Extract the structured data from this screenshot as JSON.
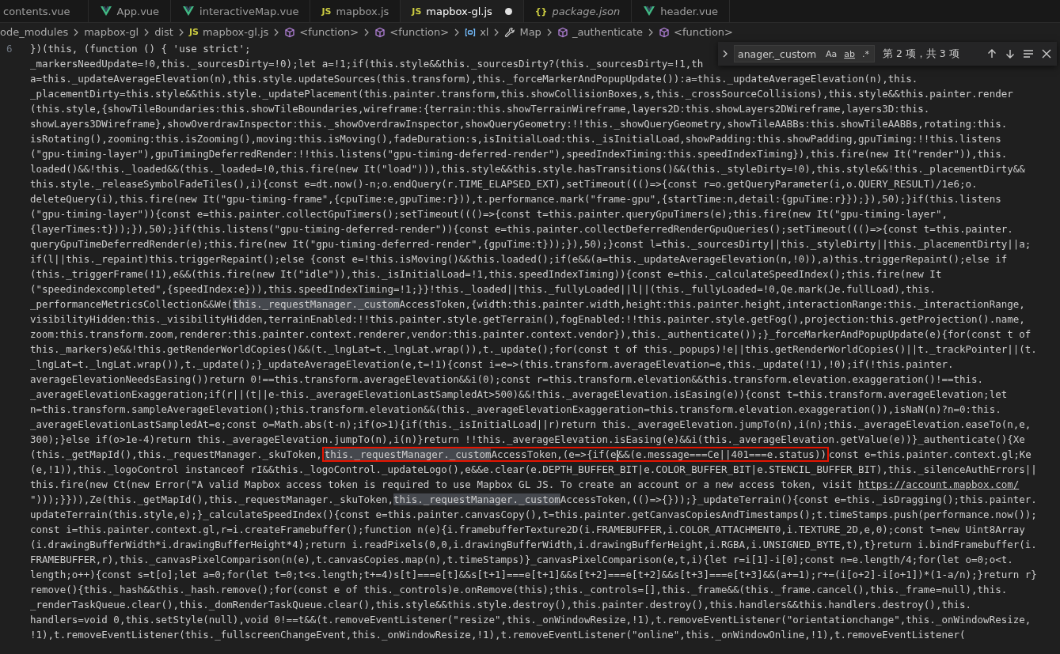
{
  "tabs": [
    {
      "label": "contents.vue",
      "selected": false,
      "modified": false,
      "preview": false
    },
    {
      "label": "App.vue",
      "kind": "vue",
      "selected": false,
      "modified": false,
      "preview": false
    },
    {
      "label": "interactiveMap.vue",
      "kind": "vue",
      "selected": false,
      "modified": false,
      "preview": false
    },
    {
      "label": "mapbox.js",
      "kind": "js",
      "icon_text": "JS",
      "selected": false,
      "modified": false,
      "preview": false
    },
    {
      "label": "mapbox-gl.js",
      "kind": "js",
      "icon_text": "JS",
      "selected": true,
      "modified": true,
      "preview": false
    },
    {
      "label": "package.json",
      "kind": "json",
      "icon_text": "{}",
      "selected": false,
      "modified": false,
      "preview": true
    },
    {
      "label": "header.vue",
      "kind": "vue",
      "selected": false,
      "modified": false,
      "preview": false
    }
  ],
  "breadcrumb": [
    {
      "label": "ode_modules"
    },
    {
      "label": "mapbox-gl"
    },
    {
      "label": "dist"
    },
    {
      "label": "mapbox-gl.js",
      "kind": "js",
      "icon_text": "JS"
    },
    {
      "label": "<function>",
      "kind": "function"
    },
    {
      "label": "<function>",
      "kind": "function"
    },
    {
      "label": "xl",
      "kind": "variable"
    },
    {
      "label": "Map",
      "kind": "property"
    },
    {
      "label": "_authenticate",
      "kind": "function"
    },
    {
      "label": "<function>",
      "kind": "function"
    }
  ],
  "find_widget": {
    "value": "anager._custom",
    "toggles": [
      {
        "kind": "case",
        "label": "Aa",
        "on": false
      },
      {
        "kind": "word",
        "label": "ab",
        "on": false
      },
      {
        "kind": "regex",
        "label": ".*",
        "on": false
      }
    ],
    "result": "第 2 项，共 3 项"
  },
  "editor": {
    "line_number": "6",
    "rows": [
      "})(this, (function () { 'use strict';",
      "_markersNeedUpdate=!0,this._sourcesDirty=!0);let a=!1;if(this.style&&this._sourcesDirty?(this._sourcesDirty=!1,th",
      "a=this._updateAverageElevation(n),this.style.updateSources(this.transform),this._forceMarkerAndPopupUpdate()):a=this._updateAverageElevation(n),this.",
      "_placementDirty=this.style&&this.style._updatePlacement(this.painter.transform,this.showCollisionBoxes,s,this._crossSourceCollisions),this.style&&this.painter.render",
      "(this.style,{showTileBoundaries:this.showTileBoundaries,wireframe:{terrain:this.showTerrainWireframe,layers2D:this.showLayers2DWireframe,layers3D:this.",
      "showLayers3DWireframe},showOverdrawInspector:this._showOverdrawInspector,showQueryGeometry:!!this._showQueryGeometry,showTileAABBs:this.showTileAABBs,rotating:this.",
      "isRotating(),zooming:this.isZooming(),moving:this.isMoving(),fadeDuration:s,isInitialLoad:this._isInitialLoad,showPadding:this.showPadding,gpuTiming:!!this.listens",
      "(\"gpu-timing-layer\"),gpuTimingDeferredRender:!!this.listens(\"gpu-timing-deferred-render\"),speedIndexTiming:this.speedIndexTiming}),this.fire(new It(\"render\")),this.",
      "loaded()&&!this._loaded&&(this._loaded=!0,this.fire(new It(\"load\"))),this.style&&this.style.hasTransitions()&&(this._styleDirty=!0),this.style&&!this._placementDirty&&",
      "this.style._releaseSymbolFadeTiles(),i){const e=dt.now()-n;o.endQuery(r.TIME_ELAPSED_EXT),setTimeout((()=>{const r=o.getQueryParameter(i,o.QUERY_RESULT)/1e6;o.",
      "deleteQuery(i),this.fire(new It(\"gpu-timing-frame\",{cpuTime:e,gpuTime:r})),t.performance.mark(\"frame-gpu\",{startTime:n,detail:{gpuTime:r}});}),50);}if(this.listens",
      "(\"gpu-timing-layer\")){const e=this.painter.collectGpuTimers();setTimeout((()=>{const t=this.painter.queryGpuTimers(e);this.fire(new It(\"gpu-timing-layer\",",
      "{layerTimes:t}));}),50);}if(this.listens(\"gpu-timing-deferred-render\")){const e=this.painter.collectDeferredRenderGpuQueries();setTimeout((()=>{const t=this.painter.",
      "queryGpuTimeDeferredRender(e);this.fire(new It(\"gpu-timing-deferred-render\",{gpuTime:t}));}),50);}const l=this._sourcesDirty||this._styleDirty||this._placementDirty||a;",
      "if(l||this._repaint)this.triggerRepaint();else {const e=!this.isMoving()&&this.loaded();if(e&&(a=this._updateAverageElevation(n,!0)),a)this.triggerRepaint();else if",
      "(this._triggerFrame(!1),e&&(this.fire(new It(\"idle\")),this._isInitialLoad=!1,this.speedIndexTiming)){const e=this._calculateSpeedIndex();this.fire(new It",
      "(\"speedindexcompleted\",{speedIndex:e})),this.speedIndexTiming=!1;}}!this._loaded||this._fullyLoaded||l||(this._fullyLoaded=!0,Qe.mark(Je.fullLoad),this.",
      [
        {
          "text": "_performanceMetricsCollection&&We("
        },
        {
          "kind": "match",
          "text": "this._requestManager._custom"
        },
        {
          "text": "AccessToken,{width:this.painter.width,height:this.painter.height,interactionRange:this._interactionRange,"
        }
      ],
      "visibilityHidden:this._visibilityHidden,terrainEnabled:!!this.painter.style.getTerrain(),fogEnabled:!!this.painter.style.getFog(),projection:this.getProjection().name,",
      "zoom:this.transform.zoom,renderer:this.painter.context.renderer,vendor:this.painter.context.vendor}),this._authenticate());}_forceMarkerAndPopupUpdate(e){for(const t of",
      "this._markers)e&&!this.getRenderWorldCopies()&&(t._lngLat=t._lngLat.wrap()),t._update();for(const t of this._popups)!e||this.getRenderWorldCopies()||t._trackPointer||(t.",
      "_lngLat=t._lngLat.wrap()),t._update();}_updateAverageElevation(e,t=!1){const i=e=>(this.transform.averageElevation=e,this._update(!1),!0);if(!this.painter.",
      "averageElevationNeedsEasing())return 0!==this.transform.averageElevation&&i(0);const r=this.transform.elevation&&this.transform.elevation.exaggeration()!==this.",
      "_averageElevationExaggeration;if(r||(t||e-this._averageElevationLastSampledAt>500)&&!this._averageElevation.isEasing(e)){const t=this.transform.averageElevation;let",
      "n=this.transform.sampleAverageElevation();this.transform.elevation&&(this._averageElevationExaggeration=this.transform.elevation.exaggeration()),isNaN(n)?n=0:this.",
      "_averageElevationLastSampledAt=e;const o=Math.abs(t-n);if(o>1){if(this._isInitialLoad||r)return this._averageElevation.jumpTo(n),i(n);this._averageElevation.easeTo(n,e,",
      "300);}else if(o>1e-4)return this._averageElevation.jumpTo(n),i(n)}return !!this._averageElevation.isEasing(e)&&i(this._averageElevation.getValue(e))}_authenticate(){Xe",
      [
        {
          "text": "(this._getMapId(),this._requestManager._skuToken,"
        },
        {
          "kind": "annotation",
          "parts": [
            {
              "kind": "match",
              "text": "this._requestManager._custom"
            },
            {
              "text": "AccessToken,(e=>{if(e"
            },
            {
              "kind": "cursor"
            },
            {
              "text": "&&(e.message===Ce||401===e.status))"
            }
          ]
        },
        {
          "text": "const e=this.painter.context.gl;Ke"
        }
      ],
      "(e,!1)),this._logoControl instanceof rI&&this._logoControl._updateLogo(),e&&e.clear(e.DEPTH_BUFFER_BIT|e.COLOR_BUFFER_BIT|e.STENCIL_BUFFER_BIT),this._silenceAuthErrors||",
      [
        {
          "text": "this.fire(new Ct(new Error(\"A valid Mapbox access token is required to use Mapbox GL JS. To create an account or a new access token, visit "
        },
        {
          "kind": "link",
          "text": "https://account.mapbox.com/"
        }
      ],
      [
        {
          "text": "\")));}})),Ze(this._getMapId(),this._requestManager._skuToken,"
        },
        {
          "kind": "match",
          "text": "this._requestManager._custom"
        },
        {
          "text": "AccessToken,(()=>{}));}_updateTerrain(){const e=this._isDragging();this.painter."
        }
      ],
      "updateTerrain(this.style,e);}_calculateSpeedIndex(){const e=this.painter.canvasCopy(),t=this.painter.getCanvasCopiesAndTimestamps();t.timeStamps.push(performance.now());",
      "const i=this.painter.context.gl,r=i.createFramebuffer();function n(e){i.framebufferTexture2D(i.FRAMEBUFFER,i.COLOR_ATTACHMENT0,i.TEXTURE_2D,e,0);const t=new Uint8Array",
      "(i.drawingBufferWidth*i.drawingBufferHeight*4);return i.readPixels(0,0,i.drawingBufferWidth,i.drawingBufferHeight,i.RGBA,i.UNSIGNED_BYTE,t),t}return i.bindFramebuffer(i.",
      "FRAMEBUFFER,r),this._canvasPixelComparison(n(e),t.canvasCopies.map(n),t.timeStamps)}_canvasPixelComparison(e,t,i){let r=i[1]-i[0];const n=e.length/4;for(let o=0;o<t.",
      "length;o++){const s=t[o];let a=0;for(let t=0;t<s.length;t+=4)s[t]===e[t]&&s[t+1]===e[t+1]&&s[t+2]===e[t+2]&&s[t+3]===e[t+3]&&(a+=1);r+=(i[o+2]-i[o+1])*(1-a/n);}return r}",
      "remove(){this._hash&&this._hash.remove();for(const e of this._controls)e.onRemove(this);this._controls=[],this._frame&&(this._frame.cancel(),this._frame=null),this.",
      "_renderTaskQueue.clear(),this._domRenderTaskQueue.clear(),this.style&&this.style.destroy(),this.painter.destroy(),this.handlers&&this.handlers.destroy(),this.",
      "handlers=void 0,this.setStyle(null),void 0!==t&&(t.removeEventListener(\"resize\",this._onWindowResize,!1),t.removeEventListener(\"orientationchange\",this._onWindowResize,",
      "!1),t.removeEventListener(this._fullscreenChangeEvent,this._onWindowResize,!1),t.removeEventListener(\"online\",this._onWindowOnline,!1),t.removeEventListener("
    ]
  }
}
